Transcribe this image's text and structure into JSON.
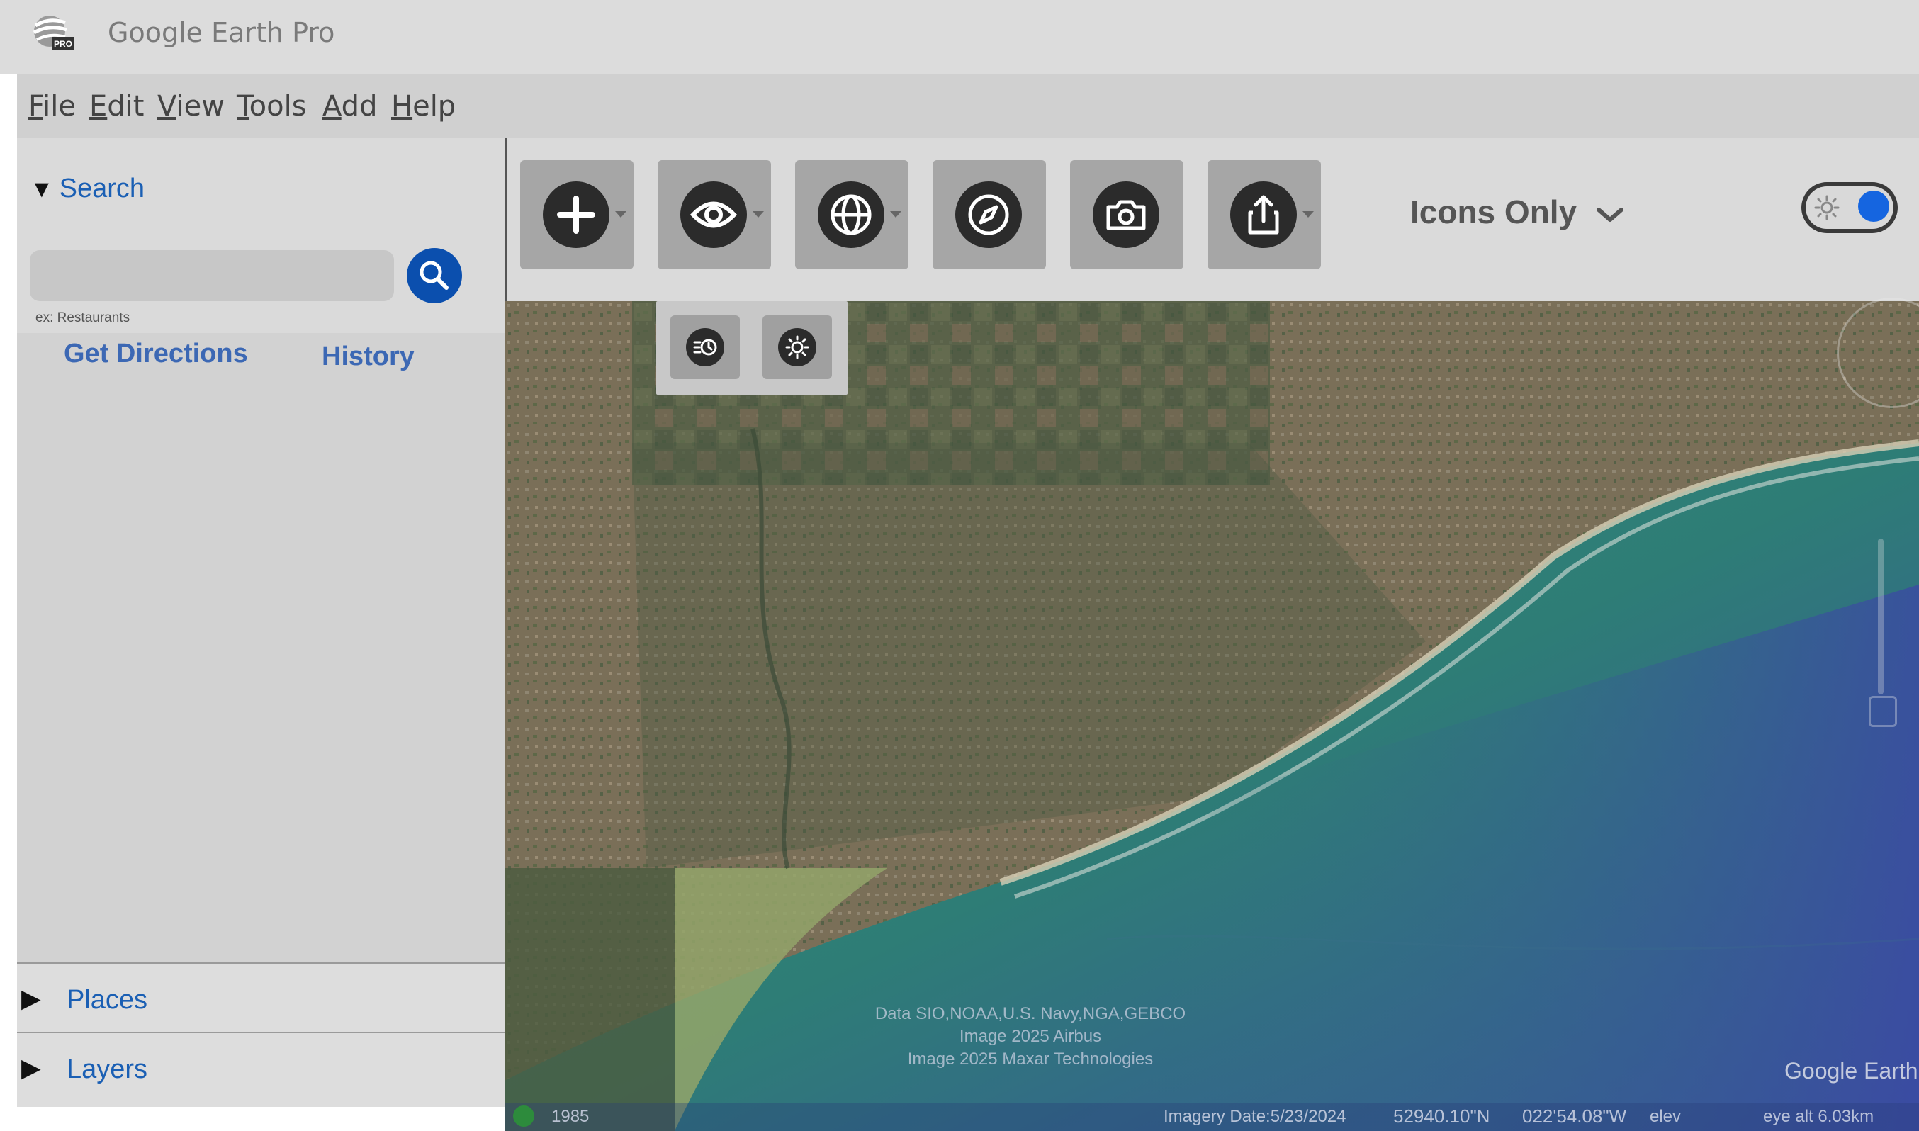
{
  "app": {
    "title": "Google Earth Pro",
    "logo_badge": "PRO"
  },
  "menu": [
    {
      "label": "File",
      "mnemonic": "F",
      "rest": "ile"
    },
    {
      "label": "Edit",
      "mnemonic": "E",
      "rest": "dit"
    },
    {
      "label": "View",
      "mnemonic": "V",
      "rest": "iew"
    },
    {
      "label": "Tools",
      "mnemonic": "T",
      "rest": "ools"
    },
    {
      "label": "Add",
      "mnemonic": "A",
      "rest": "dd"
    },
    {
      "label": "Help",
      "mnemonic": "H",
      "rest": "elp"
    }
  ],
  "toolbar": {
    "buttons": [
      {
        "icon": "plus-icon",
        "has_dropdown": true
      },
      {
        "icon": "eye-icon",
        "has_dropdown": true
      },
      {
        "icon": "globe-icon",
        "has_dropdown": true
      },
      {
        "icon": "compass-icon",
        "has_dropdown": false
      },
      {
        "icon": "camera-icon",
        "has_dropdown": false
      },
      {
        "icon": "share-icon",
        "has_dropdown": true
      }
    ],
    "display_mode": "Icons Only",
    "theme_toggle": {
      "icon": "sun-icon",
      "on": true
    }
  },
  "sub_toolbar": {
    "buttons": [
      {
        "icon": "history-clock-icon"
      },
      {
        "icon": "sun-icon"
      }
    ]
  },
  "sidebar": {
    "search": {
      "header": "Search",
      "placeholder": "",
      "value": "",
      "hint": "ex: Restaurants",
      "links": {
        "directions": "Get Directions",
        "history": "History"
      }
    },
    "panels": {
      "places": "Places",
      "layers": "Layers"
    }
  },
  "map": {
    "attribution": {
      "line1": "Data SIO,NOAA,U.S. Navy,NGA,GEBCO",
      "line2": "Image  2025 Airbus",
      "line3": "Image 2025 Maxar Technologies"
    },
    "logo": "Google Earth",
    "status": {
      "year": "1985",
      "imagery_date": "Imagery Date:5/23/2024",
      "lat": "52940.10\"N",
      "lon": "022'54.08\"W",
      "elev": "elev",
      "eye_alt": "eye alt  6.03km"
    }
  },
  "colors": {
    "accent_blue": "#1a5fb4",
    "search_button": "#0b4fae",
    "toggle_knob": "#1565e0",
    "toolbar_button": "#a6a6a6"
  }
}
